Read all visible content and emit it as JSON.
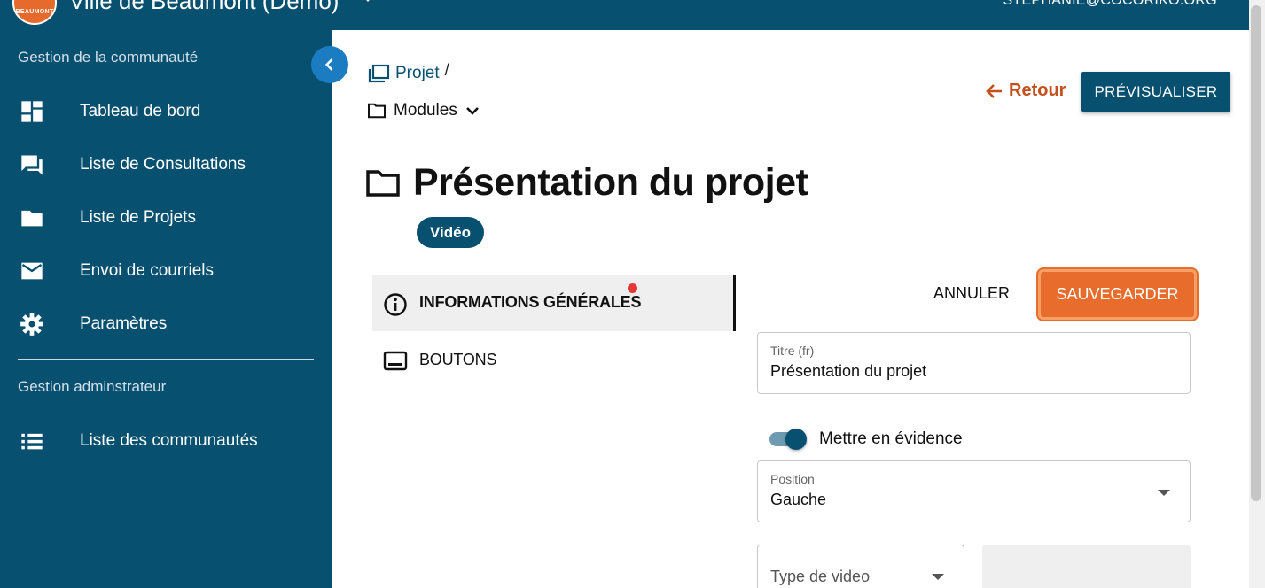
{
  "header": {
    "logo_text": "BEAUMONT",
    "title": "Ville de Beaumont (Démo)",
    "user_email": "STEPHANIE@COCORIKO.ORG"
  },
  "sidebar": {
    "section_community": "Gestion de la communauté",
    "items": [
      {
        "label": "Tableau de bord",
        "icon": "dashboard-icon"
      },
      {
        "label": "Liste de Consultations",
        "icon": "forum-icon"
      },
      {
        "label": "Liste de Projets",
        "icon": "folder-icon"
      },
      {
        "label": "Envoi de courriels",
        "icon": "mail-icon"
      },
      {
        "label": "Paramètres",
        "icon": "gear-icon"
      }
    ],
    "section_admin": "Gestion adminstrateur",
    "admin_items": [
      {
        "label": "Liste des communautés",
        "icon": "list-icon"
      }
    ]
  },
  "breadcrumb": {
    "project_link": "Projet",
    "separator": "/",
    "modules_label": "Modules"
  },
  "actions": {
    "back": "Retour",
    "preview": "PRÉVISUALISER"
  },
  "page": {
    "title": "Présentation du projet",
    "type_chip": "Vidéo"
  },
  "tabs": [
    {
      "label": "INFORMATIONS GÉNÉRALES",
      "active": true,
      "has_alert": true
    },
    {
      "label": "BOUTONS",
      "active": false
    }
  ],
  "form": {
    "cancel": "ANNULER",
    "save": "SAUVEGARDER",
    "title_label": "Titre (fr)",
    "title_value": "Présentation du projet",
    "highlight_label": "Mettre en évidence",
    "highlight_on": true,
    "position_label": "Position",
    "position_value": "Gauche",
    "video_type_placeholder": "Type de video"
  },
  "colors": {
    "primary": "#08506f",
    "accent": "#e86c2c",
    "back_link": "#c4501c",
    "alert_dot": "#e53935"
  }
}
